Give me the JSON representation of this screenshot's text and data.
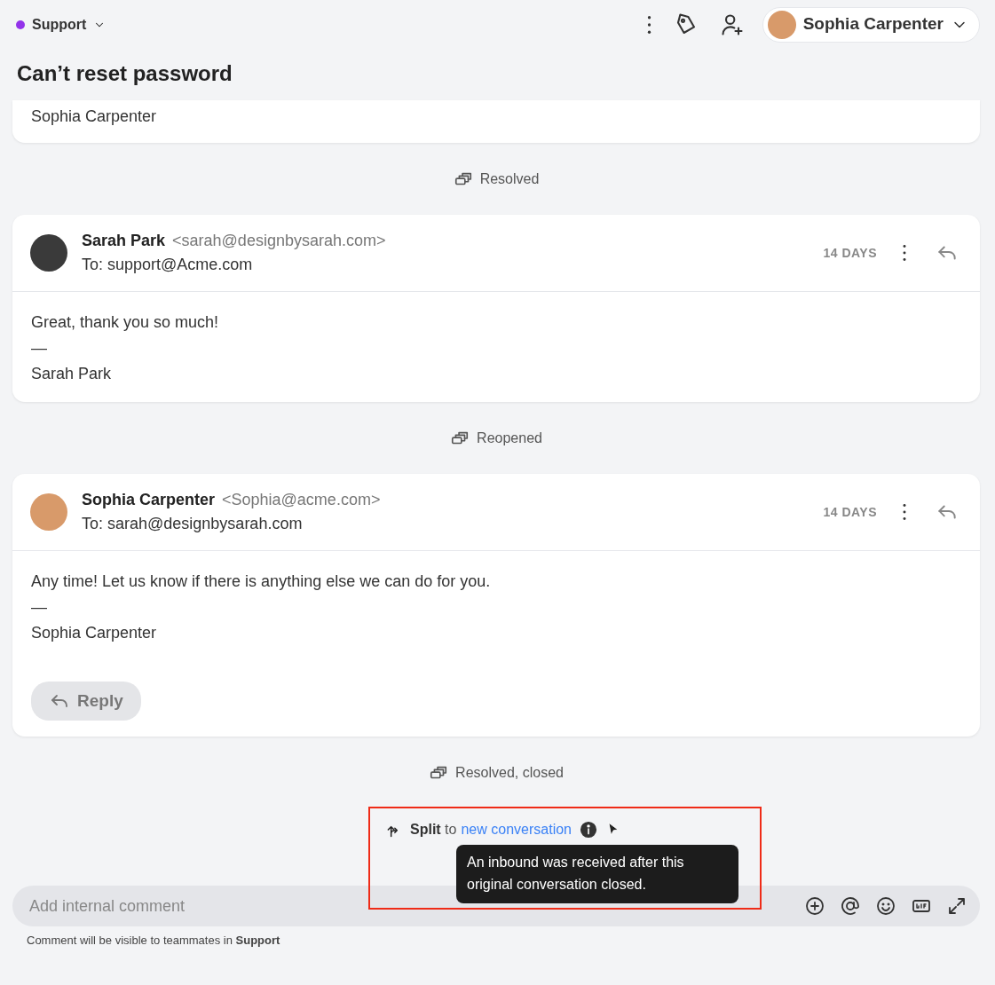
{
  "header": {
    "team": {
      "label": "Support",
      "color": "#9333ea"
    },
    "user": {
      "name": "Sophia Carpenter"
    }
  },
  "title": "Can’t reset password",
  "thread": [
    {
      "kind": "tail",
      "signature": "Sophia Carpenter"
    },
    {
      "kind": "event",
      "label": "Resolved"
    },
    {
      "kind": "message",
      "sender": "Sarah Park",
      "email": "<sarah@designbysarah.com>",
      "to_label": "To:",
      "to": "support@Acme.com",
      "age": "14 DAYS",
      "body": "Great, thank you so much!",
      "dash": "—",
      "signature": "Sarah Park"
    },
    {
      "kind": "event",
      "label": "Reopened"
    },
    {
      "kind": "message",
      "sender": "Sophia Carpenter",
      "email": "<Sophia@acme.com>",
      "to_label": "To:",
      "to": "sarah@designbysarah.com",
      "age": "14 DAYS",
      "body": "Any time! Let us know if there is anything else we can do for you.",
      "dash": "—",
      "signature": "Sophia Carpenter",
      "reply_button": "Reply"
    },
    {
      "kind": "event",
      "label": "Resolved, closed"
    },
    {
      "kind": "split",
      "text": "**Split** to",
      "link": "new conversation",
      "tooltip": "An inbound was received after this original conversation closed.",
      "highlighted": true
    }
  ],
  "composer": {
    "placeholder": "Add internal comment",
    "note": "Comment will be visible to teammates in **Support**"
  }
}
